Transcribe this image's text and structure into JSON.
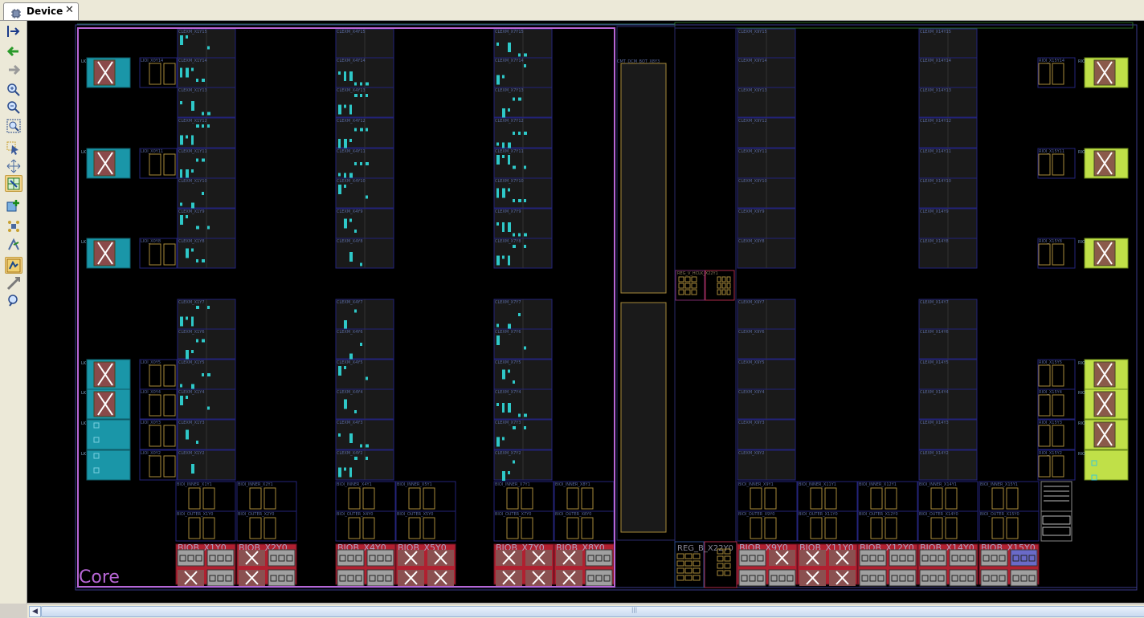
{
  "tab": {
    "title": "Device",
    "close": "✕"
  },
  "toolbar": {
    "buttons": [
      {
        "name": "autofit-selection-icon"
      },
      {
        "name": "previous-view-icon"
      },
      {
        "name": "next-view-icon"
      },
      {
        "name": "zoom-in-icon"
      },
      {
        "name": "zoom-out-icon"
      },
      {
        "name": "zoom-fit-icon"
      },
      {
        "name": "select-mode-icon"
      },
      {
        "name": "pan-mode-icon"
      },
      {
        "name": "routing-resources-icon"
      },
      {
        "name": "add-pblock-icon"
      },
      {
        "name": "place-ports-icon"
      },
      {
        "name": "autoplace-icon"
      },
      {
        "name": "show-io-icon"
      },
      {
        "name": "clock-region-icon"
      },
      {
        "name": "search-device-icon"
      }
    ]
  },
  "device": {
    "pblock_label": "Core",
    "clock_column_label": "CMT_DCM_BOT_X8Y3",
    "center_label": "REG_B_X22Y0",
    "center_small_label": "REG_V_HCLK_X22Y1",
    "left_io_cols": [
      {
        "name": "LIOB",
        "tiles": [
          {
            "label": "LIOB_X0Y14",
            "row": 1,
            "state": "unused"
          },
          {
            "label": "LIOB_X0Y11",
            "row": 4,
            "state": "unused"
          },
          {
            "label": "LIOB_X0Y8",
            "row": 7,
            "state": "unused"
          },
          {
            "label": "LIOB_X0Y5",
            "row": 11,
            "state": "unused"
          },
          {
            "label": "LIOB_X0Y4",
            "row": 12,
            "state": "unused"
          },
          {
            "label": "LIOB_X0Y3",
            "row": 13,
            "state": "used"
          },
          {
            "label": "LIOB_X0Y2",
            "row": 14,
            "state": "used"
          }
        ]
      }
    ],
    "right_io_tiles": [
      {
        "label": "RIOB_X15Y14",
        "row": 1,
        "state": "unused"
      },
      {
        "label": "RIOB_X15Y11",
        "row": 4,
        "state": "unused"
      },
      {
        "label": "RIOB_X15Y8",
        "row": 7,
        "state": "unused"
      },
      {
        "label": "RIOB_X15Y5",
        "row": 11,
        "state": "unused"
      },
      {
        "label": "RIOB_X15Y4",
        "row": 12,
        "state": "unused"
      },
      {
        "label": "RIOB_X15Y3",
        "row": 13,
        "state": "unused"
      },
      {
        "label": "RIOB_X15Y2",
        "row": 14,
        "state": "used"
      }
    ],
    "clb_columns": [
      {
        "prefix": "CLEXM_X1",
        "rows": [
          "CLEXM_X1Y15",
          "CLEXM_X1Y14",
          "CLEXM_X1Y13",
          "CLEXM_X1Y12",
          "CLEXM_X1Y11",
          "CLEXM_X1Y10",
          "CLEXM_X1Y9",
          "CLEXM_X1Y8",
          "",
          "CLEXM_X1Y7",
          "CLEXM_X1Y6",
          "CLEXM_X1Y5",
          "CLEXM_X1Y4",
          "CLEXM_X1Y3",
          "CLEXM_X1Y2"
        ],
        "density": [
          3,
          5,
          4,
          6,
          5,
          3,
          4,
          4,
          0,
          5,
          4,
          4,
          3,
          2,
          1
        ]
      },
      {
        "prefix": "CLEXM_X4",
        "rows": [
          "CLEXM_X4Y15",
          "CLEXM_X4Y14",
          "CLEXM_X4Y13",
          "CLEXM_X4Y12",
          "CLEXM_X4Y11",
          "CLEXM_X4Y10",
          "CLEXM_X4Y9",
          "CLEXM_X4Y8",
          "",
          "CLEXM_X4Y7",
          "CLEXM_X4Y6",
          "CLEXM_X4Y5",
          "CLEXM_X4Y4",
          "CLEXM_X4Y3",
          "CLEXM_X4Y2"
        ],
        "density": [
          0,
          6,
          7,
          7,
          7,
          3,
          3,
          2,
          0,
          2,
          2,
          3,
          2,
          4,
          5
        ]
      },
      {
        "prefix": "CLEXM_X7",
        "rows": [
          "CLEXM_X7Y15",
          "CLEXM_X7Y14",
          "CLEXM_X7Y13",
          "CLEXM_X7Y12",
          "CLEXM_X7Y11",
          "CLEXM_X7Y10",
          "CLEXM_X7Y9",
          "CLEXM_X7Y8",
          "",
          "CLEXM_X7Y7",
          "CLEXM_X7Y6",
          "CLEXM_X7Y5",
          "CLEXM_X7Y4",
          "CLEXM_X7Y3",
          "CLEXM_X7Y2"
        ],
        "density": [
          4,
          3,
          4,
          6,
          5,
          6,
          6,
          5,
          0,
          3,
          2,
          3,
          5,
          4,
          3
        ]
      },
      {
        "prefix": "CLEXM_X9",
        "rows": [
          "CLEXM_X9Y15",
          "CLEXM_X9Y14",
          "CLEXM_X9Y13",
          "CLEXM_X9Y12",
          "CLEXM_X9Y11",
          "CLEXM_X9Y10",
          "CLEXM_X9Y9",
          "CLEXM_X9Y8",
          "",
          "CLEXM_X9Y7",
          "CLEXM_X9Y6",
          "CLEXM_X9Y5",
          "CLEXM_X9Y4",
          "CLEXM_X9Y3",
          "CLEXM_X9Y2"
        ],
        "density": [
          0,
          0,
          0,
          0,
          0,
          0,
          0,
          0,
          0,
          0,
          0,
          0,
          0,
          0,
          0
        ]
      },
      {
        "prefix": "CLEXM_X14",
        "rows": [
          "CLEXM_X14Y15",
          "CLEXM_X14Y14",
          "CLEXM_X14Y13",
          "CLEXM_X14Y12",
          "CLEXM_X14Y11",
          "CLEXM_X14Y10",
          "CLEXM_X14Y9",
          "CLEXM_X14Y8",
          "",
          "CLEXM_X14Y7",
          "CLEXM_X14Y6",
          "CLEXM_X14Y5",
          "CLEXM_X14Y4",
          "CLEXM_X14Y3",
          "CLEXM_X14Y2"
        ],
        "density": [
          0,
          0,
          0,
          0,
          0,
          0,
          0,
          0,
          0,
          0,
          0,
          0,
          0,
          0,
          0
        ]
      }
    ],
    "bottom_io": [
      {
        "label": "BIOB_X1Y0",
        "marks": [
          "box",
          "box",
          "x",
          "box"
        ]
      },
      {
        "label": "BIOB_X2Y0",
        "marks": [
          "x",
          "box",
          "x",
          "box"
        ]
      },
      {
        "label": "BIOB_X4Y0",
        "marks": [
          "box",
          "box",
          "box",
          "box"
        ]
      },
      {
        "label": "BIOB_X5Y0",
        "marks": [
          "x",
          "x",
          "x",
          "x"
        ]
      },
      {
        "label": "BIOB_X7Y0",
        "marks": [
          "x",
          "x",
          "x",
          "x"
        ]
      },
      {
        "label": "BIOB_X8Y0",
        "marks": [
          "x",
          "box",
          "x",
          "box"
        ]
      },
      {
        "label": "BIOB_X9Y0",
        "marks": [
          "box",
          "x",
          "box",
          "box"
        ]
      },
      {
        "label": "BIOB_X11Y0",
        "marks": [
          "x",
          "x",
          "x",
          "x"
        ]
      },
      {
        "label": "BIOB_X12Y0",
        "marks": [
          "box",
          "box",
          "box",
          "box"
        ]
      },
      {
        "label": "BIOB_X14Y0",
        "marks": [
          "box",
          "box",
          "box",
          "box"
        ]
      },
      {
        "label": "BIOB_X15Y0",
        "marks": [
          "box",
          "sel",
          "box",
          "box"
        ]
      }
    ],
    "bottom_inner_left": [
      "BIOI_INNER_X1Y1",
      "BIOI_INNER_X2Y1",
      "BIOI_INNER_X4Y1",
      "BIOI_INNER_X5Y1",
      "BIOI_INNER_X7Y1",
      "BIOI_INNER_X8Y1"
    ],
    "bottom_outer_left": [
      "BIOI_OUTER_X1Y0",
      "BIOI_OUTER_X2Y0",
      "BIOI_OUTER_X4Y0",
      "BIOI_OUTER_X5Y0",
      "BIOI_OUTER_X7Y0",
      "BIOI_OUTER_X8Y0"
    ],
    "bottom_inner_right": [
      "BIOI_INNER_X9Y1",
      "BIOI_INNER_X11Y1",
      "BIOI_INNER_X12Y1",
      "BIOI_INNER_X14Y1",
      "BIOI_INNER_X15Y1"
    ],
    "bottom_outer_right": [
      "BIOI_OUTER_X9Y0",
      "BIOI_OUTER_X11Y0",
      "BIOI_OUTER_X12Y0",
      "BIOI_OUTER_X14Y0",
      "BIOI_OUTER_X15Y0"
    ],
    "colors": {
      "pblock": "#b866d6",
      "tile_border": "#23237a",
      "tile_fill": "#1a1a1a",
      "used_cell": "#2ec8c8",
      "io_used_left": "#1a96a8",
      "io_used_right": "#c0e048",
      "bank_red": "#b02030",
      "gold": "#a88a3a"
    }
  }
}
